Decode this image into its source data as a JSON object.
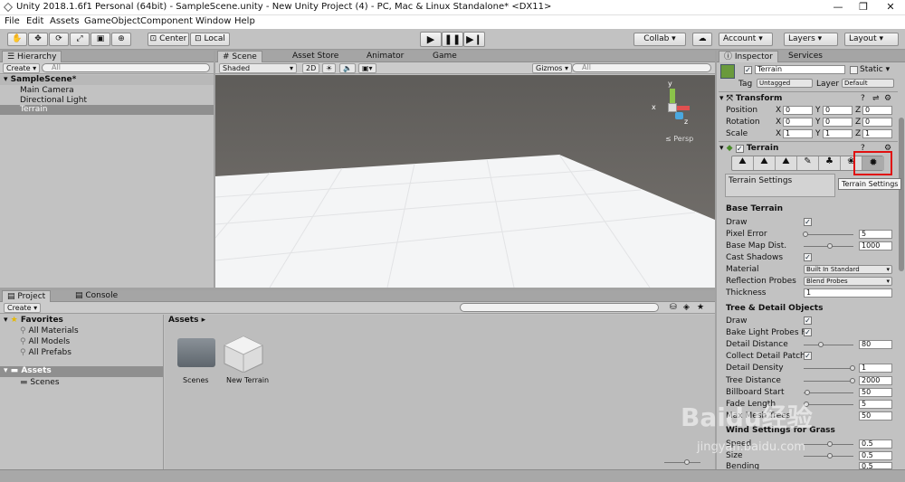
{
  "window": {
    "title": "Unity 2018.1.6f1 Personal (64bit) - SampleScene.unity - New Unity Project (4) - PC, Mac & Linux Standalone* <DX11>"
  },
  "menu": [
    "File",
    "Edit",
    "Assets",
    "GameObject",
    "Component",
    "Window",
    "Help"
  ],
  "toolbar": {
    "center": "Center",
    "local": "Local",
    "collab": "Collab ▾",
    "account": "Account",
    "layers": "Layers",
    "layout": "Layout"
  },
  "hierarchy": {
    "tab": "Hierarchy",
    "create": "Create ▾",
    "search_placeholder": "All",
    "scene": "SampleScene*",
    "items": [
      "Main Camera",
      "Directional Light",
      "Terrain"
    ]
  },
  "scene": {
    "tabs": [
      "Scene",
      "Asset Store",
      "Animator",
      "Game"
    ],
    "shaded": "Shaded",
    "mode2d": "2D",
    "gizmos": "Gizmos ▾",
    "search_placeholder": "All",
    "persp": "Persp",
    "axes": {
      "y": "y",
      "x": "x",
      "z": "z"
    }
  },
  "project": {
    "tabs": [
      "Project",
      "Console"
    ],
    "create": "Create ▾",
    "favorites": "Favorites",
    "fav_items": [
      "All Materials",
      "All Models",
      "All Prefabs"
    ],
    "assets": "Assets",
    "asset_children": [
      "Scenes"
    ],
    "breadcrumb": "Assets ▸",
    "grid": [
      "Scenes",
      "New Terrain"
    ]
  },
  "inspector": {
    "tabs": [
      "Inspector",
      "Services"
    ],
    "object_name": "Terrain",
    "static": "Static",
    "tag_label": "Tag",
    "tag": "Untagged",
    "layer_label": "Layer",
    "layer": "Default",
    "transform": {
      "title": "Transform",
      "rows": [
        {
          "label": "Position",
          "x": "0",
          "y": "0",
          "z": "0"
        },
        {
          "label": "Rotation",
          "x": "0",
          "y": "0",
          "z": "0"
        },
        {
          "label": "Scale",
          "x": "1",
          "y": "1",
          "z": "1"
        }
      ],
      "axes": [
        "X",
        "Y",
        "Z"
      ]
    },
    "terrain": {
      "title": "Terrain",
      "tool_caption": "Terrain Settings",
      "tooltip": "Terrain Settings"
    },
    "base": {
      "title": "Base Terrain",
      "draw": "Draw",
      "pixel_error": "Pixel Error",
      "pixel_error_v": "5",
      "base_map": "Base Map Dist.",
      "base_map_v": "1000",
      "cast": "Cast Shadows",
      "material": "Material",
      "material_v": "Built In Standard",
      "probes": "Reflection Probes",
      "probes_v": "Blend Probes",
      "thickness": "Thickness",
      "thickness_v": "1"
    },
    "tree": {
      "title": "Tree & Detail Objects",
      "draw": "Draw",
      "bake": "Bake Light Probes Fo",
      "detail_distance": "Detail Distance",
      "detail_distance_v": "80",
      "collect": "Collect Detail Patche",
      "detail_density": "Detail Density",
      "detail_density_v": "1",
      "tree_distance": "Tree Distance",
      "tree_distance_v": "2000",
      "billboard": "Billboard Start",
      "billboard_v": "50",
      "fade": "Fade Length",
      "fade_v": "5",
      "max_mesh": "Max Mesh Trees",
      "max_mesh_v": "50"
    },
    "wind": {
      "title": "Wind Settings for Grass",
      "speed": "Speed",
      "speed_v": "0.5",
      "size": "Size",
      "size_v": "0.5",
      "bending": "Bending",
      "bending_v": "0.5"
    }
  },
  "watermark": {
    "brand": "Baidu经验",
    "url": "jingyan.baidu.com"
  }
}
